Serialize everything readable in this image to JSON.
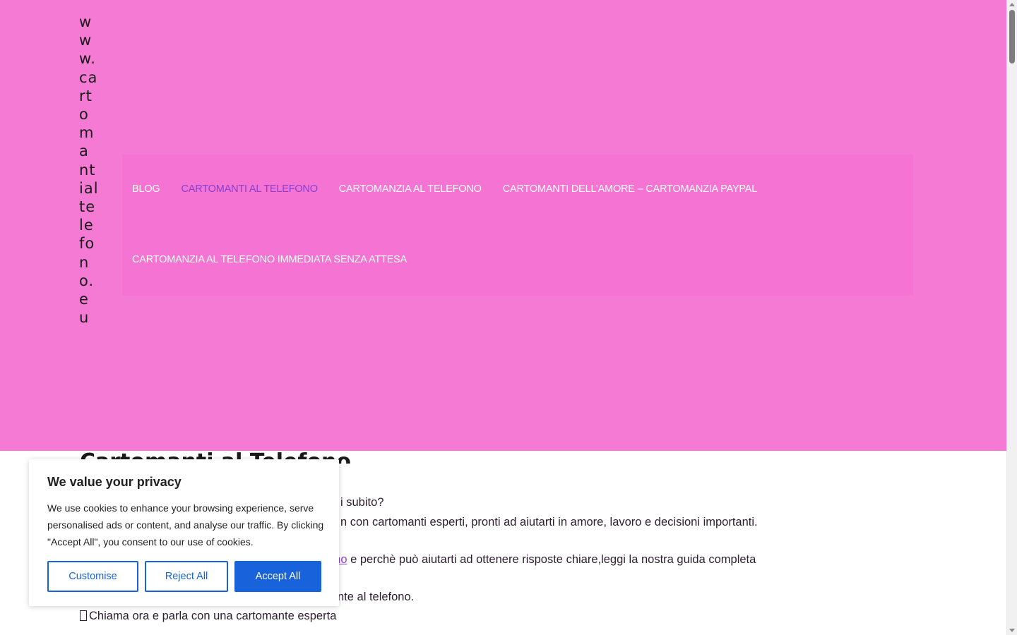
{
  "header": {
    "site_title": "www.cartomantialtelefono.eu",
    "background_color": "#f47ad4"
  },
  "nav": {
    "items": [
      {
        "label": "BLOG",
        "active": false
      },
      {
        "label": "CARTOMANTI AL TELEFONO",
        "active": true
      },
      {
        "label": "CARTOMANZIA AL TELEFONO",
        "active": false
      },
      {
        "label": "CARTOMANTI DELL’AMORE – CARTOMANZIA PAYPAL",
        "active": false
      },
      {
        "label": "CARTOMANZIA AL TELEFONO IMMEDIATA SENZA ATTESA",
        "active": false
      }
    ],
    "active_color": "#8a3fd0"
  },
  "main": {
    "heading": "Cartomanti al Telefono",
    "lines": [
      "i subito?",
      "n con cartomanti esperti, pronti ad aiutarti in amore, lavoro e decisioni importanti.",
      "e perchè può aiutarti ad ottenere risposte chiare,leggi la nostra guida completa",
      "nte al telefono.",
      "Chiama ora e parla con una cartomante esperta"
    ],
    "link_fragment": "ono",
    "bullet_icon": "missing-glyph-icon"
  },
  "cookie_banner": {
    "title": "We value your privacy",
    "text": "We use cookies to enhance your browsing experience, serve personalised ads or content, and analyse our traffic. By clicking \"Accept All\", you consent to our use of cookies.",
    "customise_label": "Customise",
    "reject_label": "Reject All",
    "accept_label": "Accept All",
    "accent_color": "#1863dc"
  }
}
